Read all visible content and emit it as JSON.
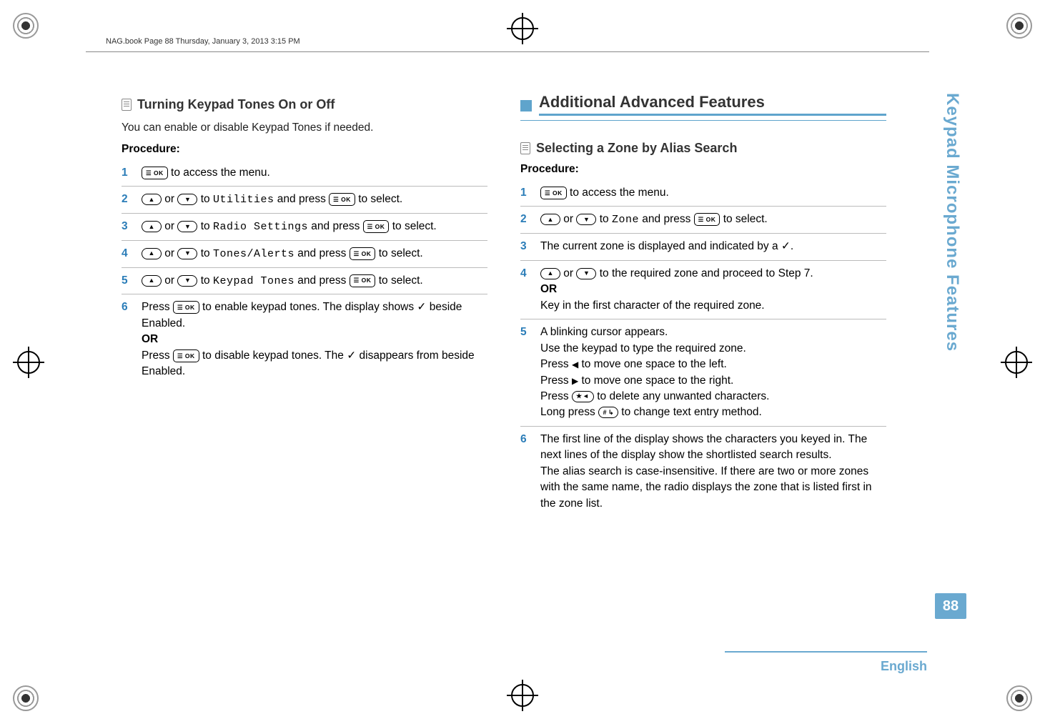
{
  "book_header": "NAG.book  Page 88  Thursday, January 3, 2013  3:15 PM",
  "left": {
    "heading": "Turning Keypad Tones On or Off",
    "intro": "You can enable or disable Keypad Tones if needed.",
    "procedure_label": "Procedure:",
    "steps": {
      "s1_suffix": " to access the menu.",
      "s2_mid_a": " or ",
      "s2_mid_b": " to ",
      "s2_menu": "Utilities",
      "s2_tail_a": " and press ",
      "s2_tail_b": " to select.",
      "s3_menu": "Radio Settings",
      "s4_menu": "Tones/Alerts",
      "s5_menu": "Keypad Tones",
      "s6_a": "Press ",
      "s6_b": " to enable keypad tones. The display shows ",
      "s6_c": " beside Enabled.",
      "s6_or": "OR",
      "s6_d": "Press ",
      "s6_e": " to disable keypad tones. The ",
      "s6_f": " disappears from beside Enabled."
    }
  },
  "right": {
    "major_heading": "Additional Advanced Features",
    "sub_heading": "Selecting a Zone by Alias Search",
    "procedure_label": "Procedure:",
    "steps": {
      "s1_suffix": " to access the menu.",
      "s2_menu": "Zone",
      "s2_mid_a": " or ",
      "s2_mid_b": " to ",
      "s2_tail_a": " and press ",
      "s2_tail_b": " to select.",
      "s3_a": "The current zone is displayed and indicated by a ",
      "s3_b": ".",
      "s4_a_mid": " or ",
      "s4_b": " to the required zone and proceed to Step 7.",
      "s4_or": "OR",
      "s4_c": "Key in the first character of the required zone.",
      "s5_a": "A blinking cursor appears.",
      "s5_b": "Use the keypad to type the required zone.",
      "s5_c_pre": "Press ",
      "s5_c_post": " to move one space to the left.",
      "s5_d_pre": "Press ",
      "s5_d_post": " to move one space to the right.",
      "s5_e_pre": "Press ",
      "s5_e_post": " to delete any unwanted characters.",
      "s5_f_pre": "Long press ",
      "s5_f_post": " to change text entry method.",
      "s6": "The first line of the display shows the characters you keyed in. The next lines of the display show the shortlisted search results.\nThe alias search is case-insensitive. If there are two or more zones with the same name, the radio displays the zone that is listed first in the zone list."
    }
  },
  "side_tab": "Keypad Microphone Features",
  "page_number": "88",
  "footer_lang": "English",
  "glyphs": {
    "check": "✓"
  }
}
